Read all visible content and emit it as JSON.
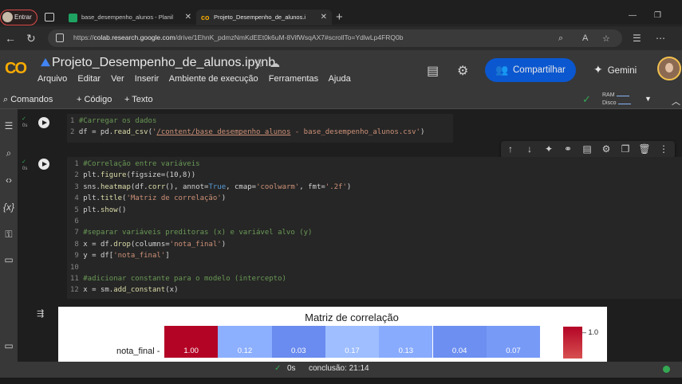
{
  "browser": {
    "profile_label": "Entrar",
    "tabs": [
      {
        "title": "base_desempenho_alunos - Planil"
      },
      {
        "title": "Projeto_Desempenho_de_alunos.i"
      }
    ],
    "url_prefix": "https://",
    "url_host": "colab.research.google.com",
    "url_path": "/drive/1EhnK_pdmzNmKdEEt0k6uM-8VifWsqAX7#scrollTo=YdlwLp4FRQ0b"
  },
  "colab": {
    "notebook_title": "Projeto_Desempenho_de_alunos.ipynb",
    "menu": [
      "Arquivo",
      "Editar",
      "Ver",
      "Inserir",
      "Ambiente de execução",
      "Ferramentas",
      "Ajuda"
    ],
    "share_label": "Compartilhar",
    "gemini_label": "Gemini"
  },
  "toolbar": {
    "commands_label": "Comandos",
    "add_code_label": "+ Código",
    "add_text_label": "+ Texto",
    "ram_label": "RAM",
    "disk_label": "Disco"
  },
  "cells": [
    {
      "time": "0s",
      "lines": [
        "#Carregar os dados",
        "df = pd.read_csv('/content/base_desempenho_alunos - base_desempenho_alunos.csv')"
      ]
    },
    {
      "time": "0s",
      "lines": [
        "#Correlação entre variáveis",
        "plt.figure(figsize=(10,8))",
        "sns.heatmap(df.corr(), annot=True, cmap='coolwarm', fmt='.2f')",
        "plt.title('Matriz de correlação')",
        "plt.show()",
        "",
        "#separar variáveis preditoras (x) e variável alvo (y)",
        "x = df.drop(columns='nota_final')",
        "y = df['nota_final']",
        "",
        "#adicionar constante para o modelo (intercepto)",
        "x = sm.add_constant(x)"
      ]
    }
  ],
  "output": {
    "plot_title": "Matriz de correlação",
    "row_label": "nota_final",
    "colorbar_max": "1.0"
  },
  "chart_data": {
    "type": "heatmap",
    "title": "Matriz de correlação",
    "rows": [
      "nota_final"
    ],
    "values": [
      [
        1.0,
        0.12,
        0.03,
        0.17,
        0.13,
        0.04,
        0.07
      ]
    ],
    "display_values": [
      "1.00",
      "0.12",
      "0.03",
      "0.17",
      "0.13",
      "0.04",
      "0.07"
    ],
    "colors": [
      "#b40426",
      "#8caffe",
      "#6a8bef",
      "#9ebeff",
      "#88abfd",
      "#6c8ff1",
      "#779af7"
    ],
    "cmap": "coolwarm",
    "colorbar_tick": "1.0"
  },
  "status": {
    "time": "0s",
    "completion": "conclusão: 21:14"
  }
}
